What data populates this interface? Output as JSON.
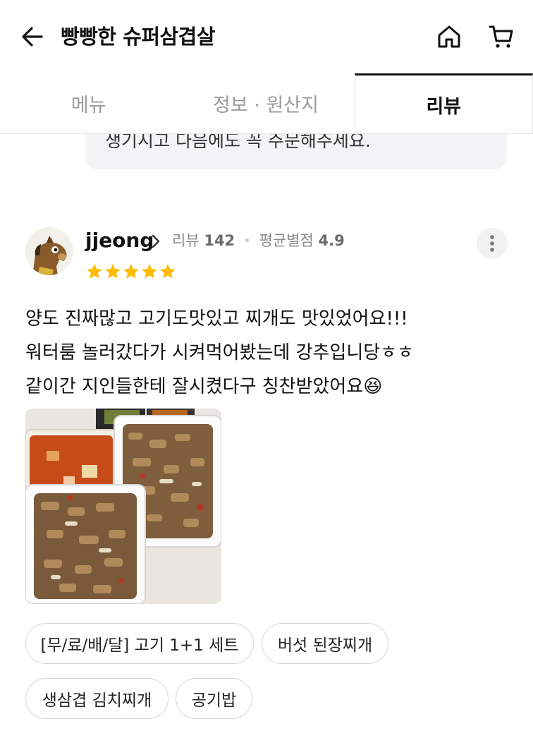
{
  "header": {
    "title": "빵빵한 슈퍼삼겹살",
    "back_icon": "arrow-left-icon",
    "home_icon": "home-icon",
    "cart_icon": "cart-icon"
  },
  "tabs": [
    {
      "label": "메뉴",
      "active": false
    },
    {
      "label": "정보 · 원산지",
      "active": false
    },
    {
      "label": "리뷰",
      "active": true
    }
  ],
  "owner_reply": {
    "text": "생기시고 다음에도 꼭 주문해주세요."
  },
  "review": {
    "username": "jjeong",
    "review_label": "리뷰",
    "review_count": "142",
    "avg_label": "평균별점",
    "avg_rating": "4.9",
    "stars": 5,
    "lines": [
      "양도 진짜많고 고기도맛있고 찌개도 맛있었어요!!!",
      "워터룸 놀러갔다가 시켜먹어봤는데 강추입니당ㅎㅎ",
      "같이간 지인들한테 잘시켰다구 칭찬받았어요"
    ],
    "emoji": "😆",
    "menu_chips": [
      "[무/료/배/달] 고기 1+1 세트",
      "버섯 된장찌개",
      "생삼겹 김치찌개",
      "공기밥"
    ]
  },
  "colors": {
    "star": "#ffbb00",
    "text": "#111111",
    "muted": "#9a9a9a",
    "bubble": "#f3f4f6"
  }
}
